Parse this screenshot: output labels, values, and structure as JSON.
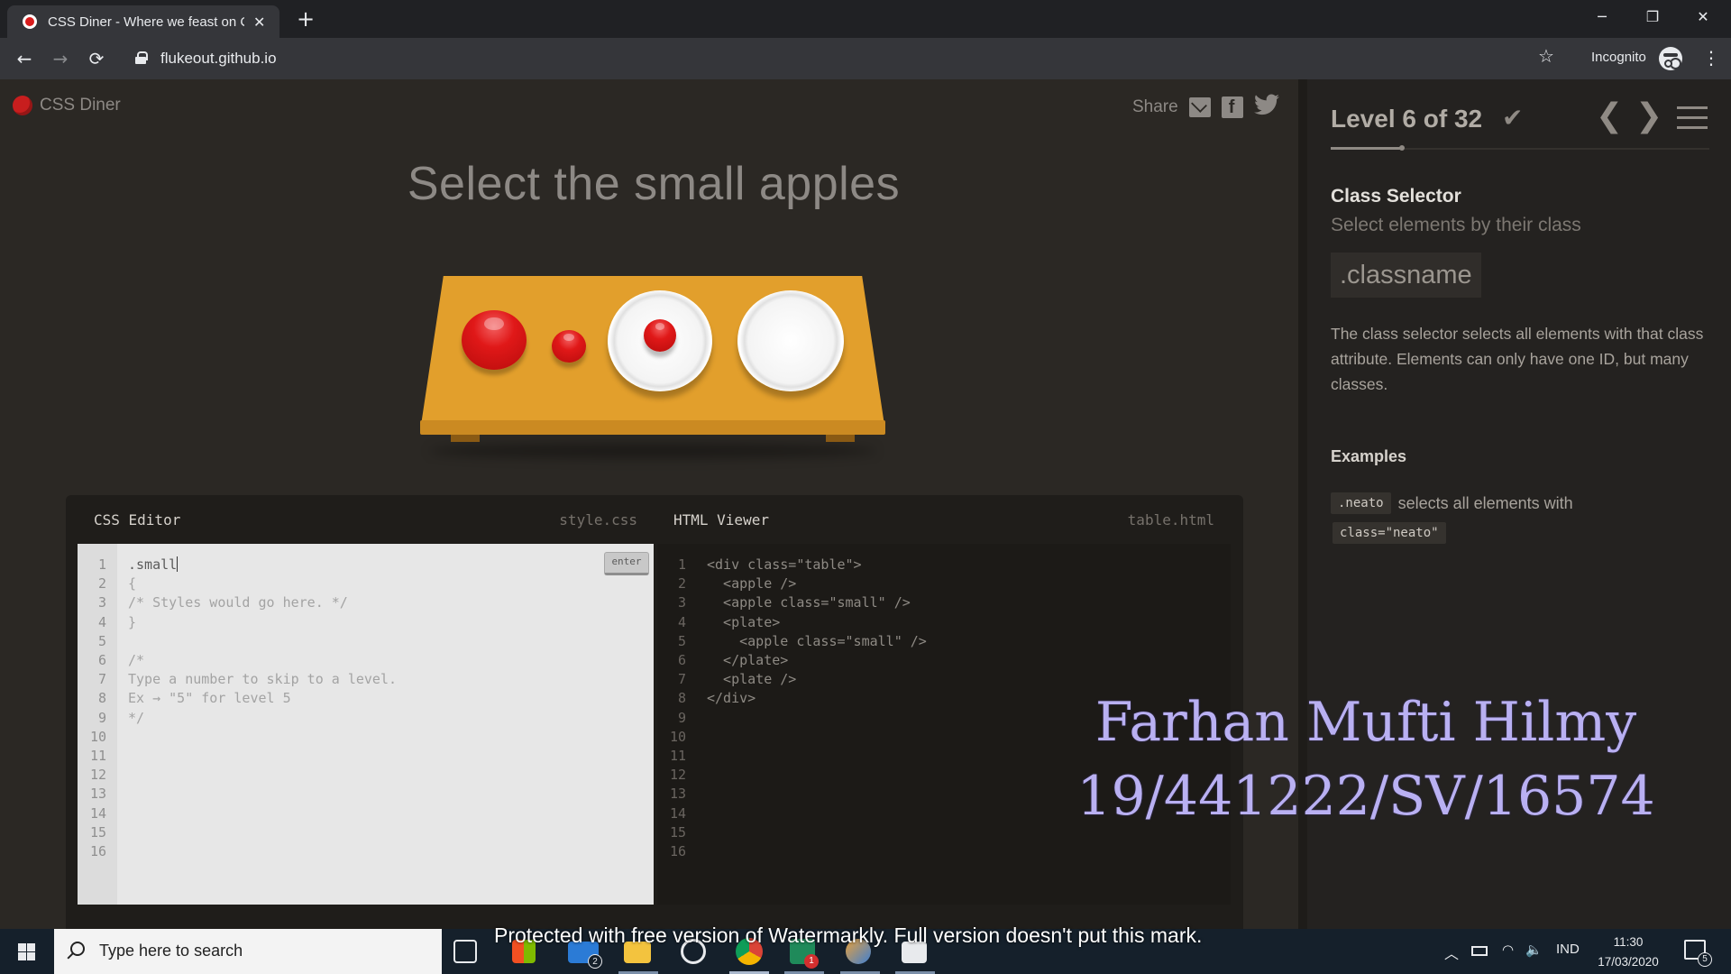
{
  "browser": {
    "tab_title": "CSS Diner - Where we feast on C",
    "tab_close": "✕",
    "new_tab": "+",
    "window_minimize": "─",
    "window_restore": "❐",
    "window_close": "✕",
    "back": "←",
    "forward": "→",
    "reload": "⟳",
    "url": "flukeout.github.io",
    "bookmark": "☆",
    "incognito_label": "Incognito",
    "menu": "⋮"
  },
  "site": {
    "logo_text": "CSS Diner",
    "share_label": "Share",
    "twitter_glyph": "🐦"
  },
  "game": {
    "instruction": "Select the small apples",
    "table_items": [
      {
        "type": "apple",
        "size": "large"
      },
      {
        "type": "apple",
        "size": "small"
      },
      {
        "type": "plate",
        "contains": "small apple"
      },
      {
        "type": "plate",
        "contains": ""
      }
    ]
  },
  "css_editor": {
    "title": "CSS Editor",
    "filename": "style.css",
    "input_value": ".small",
    "enter_label": "enter",
    "line_numbers": [
      "1",
      "2",
      "3",
      "4",
      "5",
      "6",
      "7",
      "8",
      "9",
      "10",
      "11",
      "12",
      "13",
      "14",
      "15",
      "16"
    ],
    "lines": [
      "{",
      "/* Styles would go here. */",
      "}",
      "",
      "/*",
      "Type a number to skip to a level.",
      "Ex → \"5\" for level 5",
      "*/"
    ]
  },
  "html_viewer": {
    "title": "HTML Viewer",
    "filename": "table.html",
    "line_numbers": [
      "1",
      "2",
      "3",
      "4",
      "5",
      "6",
      "7",
      "8",
      "9",
      "10",
      "11",
      "12",
      "13",
      "14",
      "15",
      "16"
    ],
    "lines": [
      "<div class=\"table\">",
      "  <apple />",
      "  <apple class=\"small\" />",
      "  <plate>",
      "    <apple class=\"small\" />",
      "  </plate>",
      "  <plate />",
      "</div>"
    ]
  },
  "sidebar": {
    "level_label": "Level 6 of 32",
    "level_current": 6,
    "level_total": 32,
    "completed_check": "✔",
    "prev": "❮",
    "next": "❯",
    "selector_name": "Class Selector",
    "selector_title": "Select elements by their class",
    "syntax": ".classname",
    "hint": "The class selector selects all elements with that class attribute. Elements can only have one ID, but many classes.",
    "examples_title": "Examples",
    "example_code": ".neato",
    "example_text": "selects all elements with",
    "example_code2": "class=\"neato\""
  },
  "overlay": {
    "student_name": "Farhan Mufti Hilmy",
    "student_id": "19/441222/SV/16574",
    "watermark": "Protected with free version of Watermarkly. Full version doesn't put this mark."
  },
  "taskbar": {
    "search_placeholder": "Type here to search",
    "mail_badge": "2",
    "app_badge": "1",
    "language": "IND",
    "time": "11:30",
    "date": "17/03/2020",
    "notifications": "5"
  },
  "colors": {
    "apple_red": "#e01818",
    "table_wood": "#e29f2c",
    "watermark_purple": "#b9b0f2"
  }
}
